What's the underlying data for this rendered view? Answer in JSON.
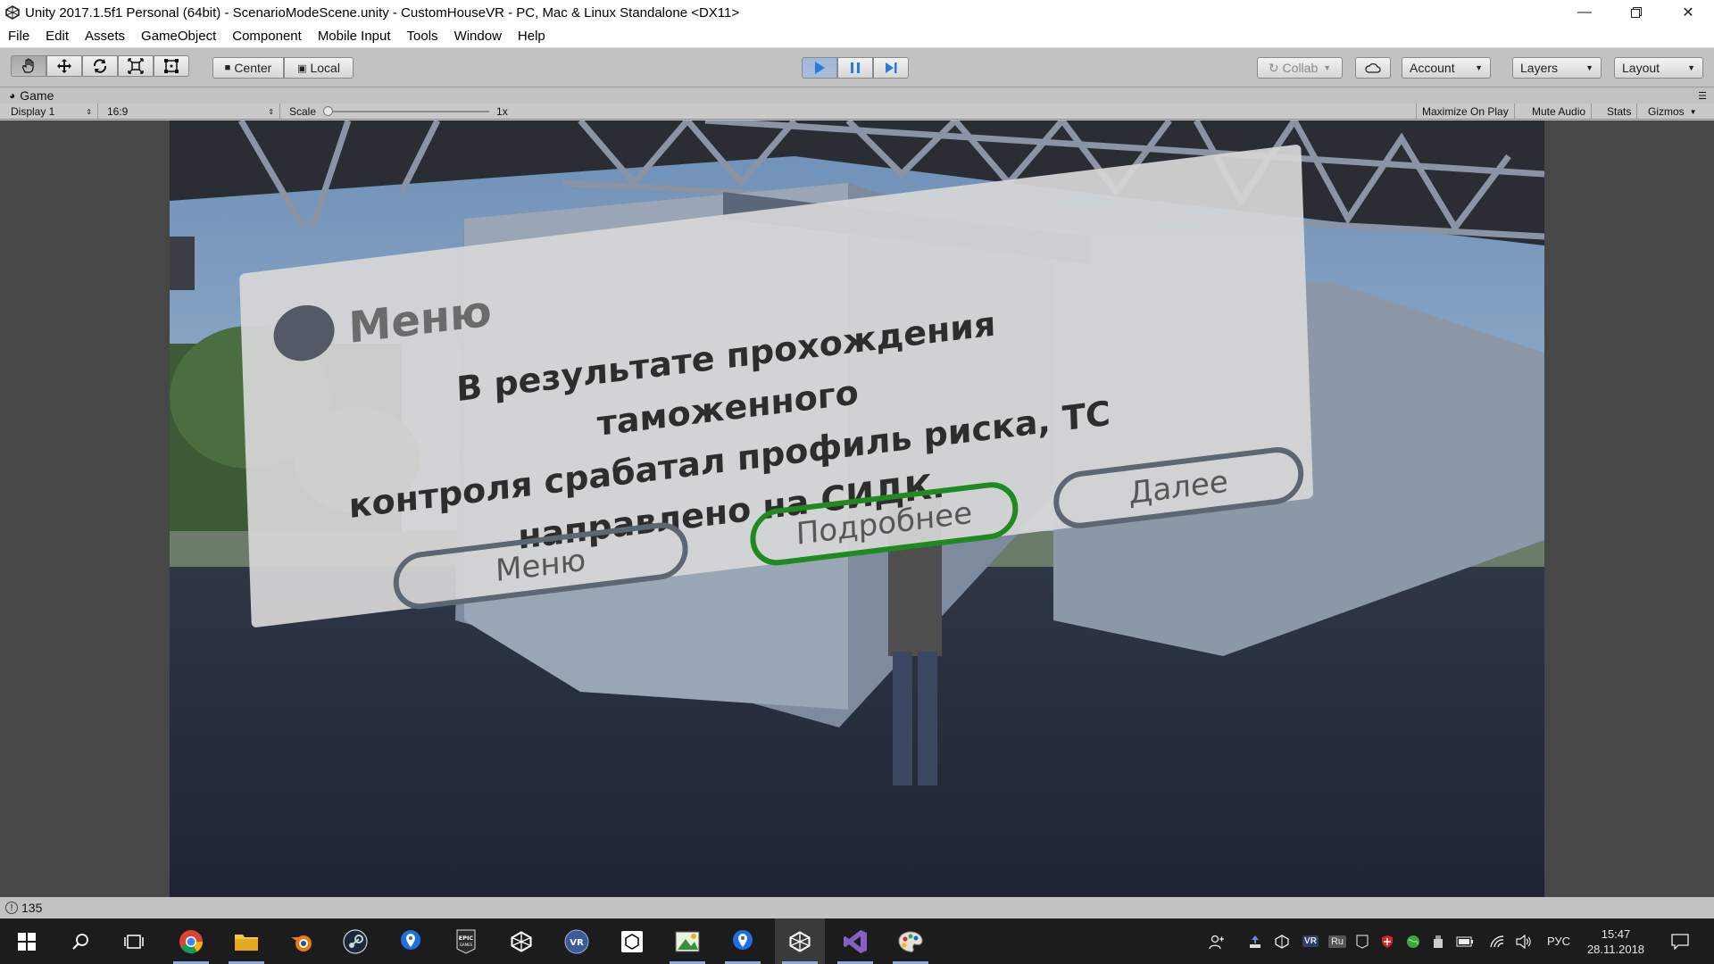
{
  "window": {
    "title": "Unity 2017.1.5f1 Personal (64bit) - ScenarioModeScene.unity - CustomHouseVR - PC, Mac & Linux Standalone <DX11>"
  },
  "menu": [
    "File",
    "Edit",
    "Assets",
    "GameObject",
    "Component",
    "Mobile Input",
    "Tools",
    "Window",
    "Help"
  ],
  "toolbar": {
    "pivot_label": "Center",
    "space_label": "Local",
    "collab_label": "Collab",
    "account_label": "Account",
    "layers_label": "Layers",
    "layout_label": "Layout"
  },
  "game_tab": {
    "label": "Game"
  },
  "game_bar": {
    "display": "Display 1",
    "aspect": "16:9",
    "scale_label": "Scale",
    "scale_value": "1x",
    "maximize": "Maximize On Play",
    "mute": "Mute Audio",
    "stats": "Stats",
    "gizmos": "Gizmos"
  },
  "dialog": {
    "title": "Меню",
    "message_lines": [
      "В результате прохождения таможенного",
      "контроля срабатал профиль риска, ТС",
      "направлено на СИДК."
    ],
    "buttons": {
      "menu": "Меню",
      "details": "Подробнее",
      "next": "Далее"
    }
  },
  "status": {
    "count": "135"
  },
  "tray": {
    "lang": "РУС",
    "time": "15:47",
    "date": "28.11.2018",
    "ru_badge": "Ru",
    "vr_badge": "VR"
  },
  "colors": {
    "accent_green": "#1f8a1f",
    "play_blue": "#2d7bd8"
  }
}
